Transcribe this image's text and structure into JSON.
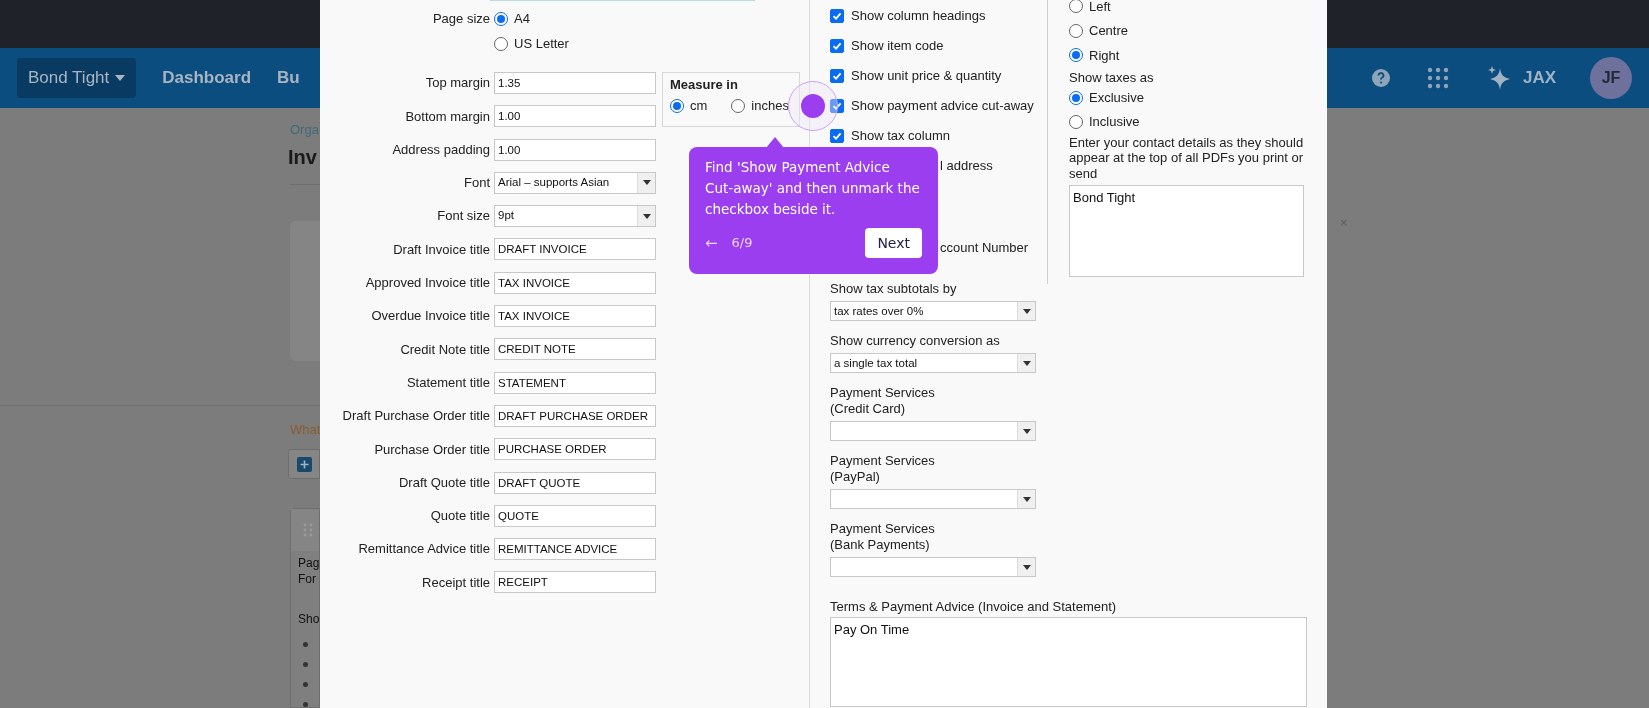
{
  "background": {
    "org_button": "Bond Tight",
    "nav": [
      "Dashboard",
      "Bu"
    ],
    "breadcrumb": "Orga",
    "page_title": "Inv",
    "link": "What",
    "card_lines": [
      "Pag",
      "For",
      "Sho"
    ],
    "assistant": "JAX",
    "avatar": "JF",
    "close": "×"
  },
  "dialog": {
    "page_size": {
      "label": "Page size",
      "options": [
        {
          "label": "A4",
          "selected": true
        },
        {
          "label": "US Letter",
          "selected": false
        }
      ]
    },
    "measure": {
      "title": "Measure in",
      "options": [
        {
          "label": "cm",
          "selected": true
        },
        {
          "label": "inches",
          "selected": false
        }
      ]
    },
    "fields": [
      {
        "label": "Top margin",
        "value": "1.35",
        "kind": "text"
      },
      {
        "label": "Bottom margin",
        "value": "1.00",
        "kind": "text"
      },
      {
        "label": "Address padding",
        "value": "1.00",
        "kind": "text"
      },
      {
        "label": "Font",
        "value": "Arial – supports Asian",
        "kind": "select"
      },
      {
        "label": "Font size",
        "value": "9pt",
        "kind": "select"
      },
      {
        "label": "Draft Invoice title",
        "value": "DRAFT INVOICE",
        "kind": "text"
      },
      {
        "label": "Approved Invoice title",
        "value": "TAX INVOICE",
        "kind": "text"
      },
      {
        "label": "Overdue Invoice title",
        "value": "TAX INVOICE",
        "kind": "text"
      },
      {
        "label": "Credit Note title",
        "value": "CREDIT NOTE",
        "kind": "text"
      },
      {
        "label": "Statement title",
        "value": "STATEMENT",
        "kind": "text"
      },
      {
        "label": "Draft Purchase Order title",
        "value": "DRAFT PURCHASE ORDER",
        "kind": "text"
      },
      {
        "label": "Purchase Order title",
        "value": "PURCHASE ORDER",
        "kind": "text"
      },
      {
        "label": "Draft Quote title",
        "value": "DRAFT QUOTE",
        "kind": "text"
      },
      {
        "label": "Quote title",
        "value": "QUOTE",
        "kind": "text"
      },
      {
        "label": "Remittance Advice title",
        "value": "REMITTANCE ADVICE",
        "kind": "text"
      },
      {
        "label": "Receipt title",
        "value": "RECEIPT",
        "kind": "text"
      }
    ],
    "options": [
      {
        "label": "Show column headings",
        "checked": true,
        "kind": "checkbox"
      },
      {
        "label": "Show item code",
        "checked": true,
        "kind": "checkbox"
      },
      {
        "label": "Show unit price & quantity",
        "checked": true,
        "kind": "checkbox"
      },
      {
        "label": "Show payment advice cut-away",
        "checked": true,
        "kind": "checkbox"
      },
      {
        "label": "Show tax column",
        "checked": true,
        "kind": "checkbox"
      },
      {
        "label": "l address",
        "kind": "covered"
      },
      {
        "label": "ccount Number",
        "kind": "covered"
      }
    ],
    "alignment": [
      {
        "label": "Left",
        "selected": false
      },
      {
        "label": "Centre",
        "selected": false
      },
      {
        "label": "Right",
        "selected": true
      }
    ],
    "taxes": {
      "label": "Show taxes as",
      "options": [
        {
          "label": "Exclusive",
          "selected": true
        },
        {
          "label": "Inclusive",
          "selected": false
        }
      ]
    },
    "contact": {
      "label": "Enter your contact details as they should appear at the top of all PDFs you print or send",
      "value": "Bond Tight"
    },
    "selects": [
      {
        "label": "Show tax subtotals by",
        "value": "tax rates over 0%"
      },
      {
        "label": "Show currency conversion as",
        "value": "a single tax total"
      },
      {
        "label": "Payment Services\n(Credit Card)"
      },
      {
        "label": "Payment Services\n(PayPal)"
      },
      {
        "label": "Payment Services\n(Bank Payments)"
      }
    ],
    "terms": {
      "label": "Terms & Payment Advice (Invoice and Statement)",
      "value": "Pay On Time"
    }
  },
  "tour": {
    "text": "Find 'Show Payment Advice Cut-away' and then unmark the checkbox beside it.",
    "back": "←",
    "step": "6/9",
    "next": "Next"
  }
}
